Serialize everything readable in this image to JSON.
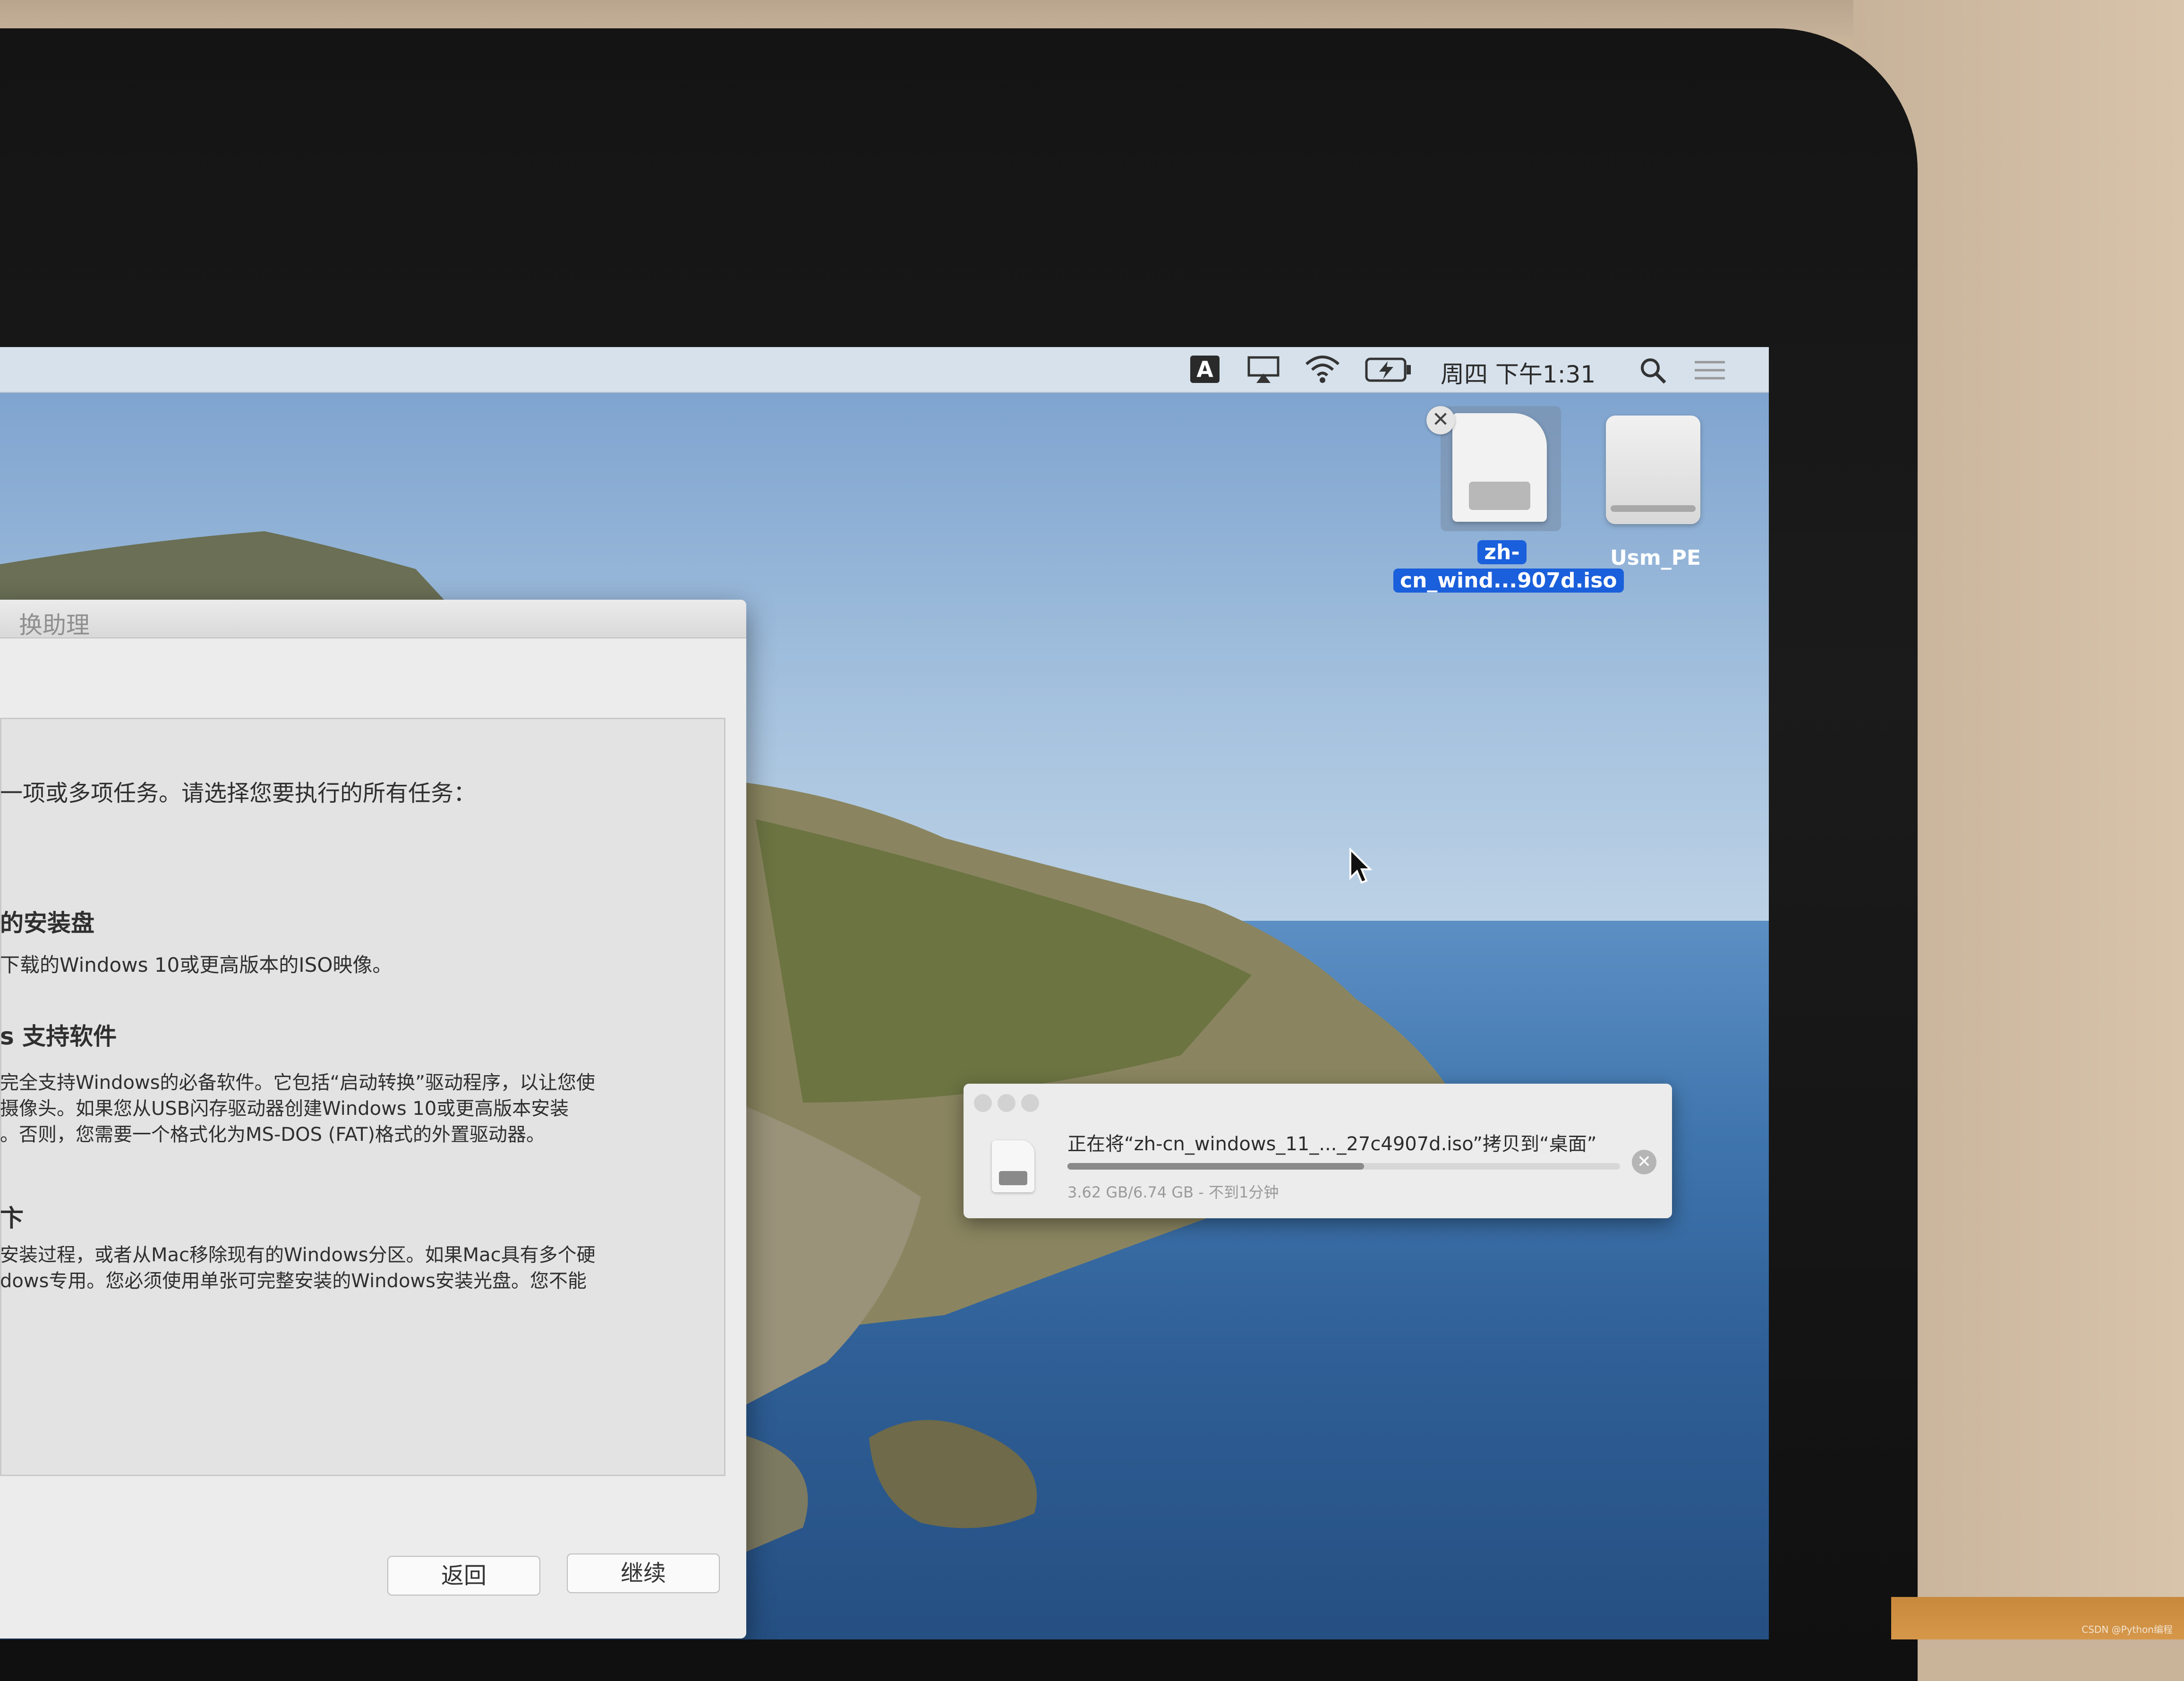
{
  "menubar": {
    "keyboard_indicator": "A",
    "icons": [
      "airplay-icon",
      "wifi-icon",
      "battery-icon",
      "search-icon",
      "notification-center-icon"
    ],
    "clock": "周四 下午1:31"
  },
  "desktop_icons": [
    {
      "name": "iso-file",
      "label_line1": "zh-",
      "label_line2": "cn_wind...907d.iso",
      "selected": true
    },
    {
      "name": "usb-drive",
      "label": "Usm_PE",
      "selected": false
    }
  ],
  "bootcamp_window": {
    "title": "换助理",
    "intro": "一项或多项任务。请选择您要执行的所有任务：",
    "section1_heading": "的安装盘",
    "section1_desc": "下载的Windows 10或更高版本的ISO映像。",
    "section2_heading": "s 支持软件",
    "section2_line1": "完全支持Windows的必备软件。它包括“启动转换”驱动程序，以让您使",
    "section2_line2": "摄像头。如果您从USB闪存驱动器创建Windows 10或更高版本安装",
    "section2_line3": "。否则，您需要一个格式化为MS-DOS (FAT)格式的外置驱动器。",
    "section3_heading": "卞",
    "section3_line1": "安装过程，或者从Mac移除现有的Windows分区。如果Mac具有多个硬",
    "section3_line2": "dows专用。您必须使用单张可完整安装的Windows安装光盘。您不能",
    "back_button": "返回",
    "continue_button": "继续"
  },
  "copy_dialog": {
    "message": "正在将“zh-cn_windows_11_..._27c4907d.iso”拷贝到“桌面”",
    "status": "3.62 GB/6.74 GB - 不到1分钟",
    "progress": 0.537
  },
  "watermark": "CSDN @Python编程"
}
